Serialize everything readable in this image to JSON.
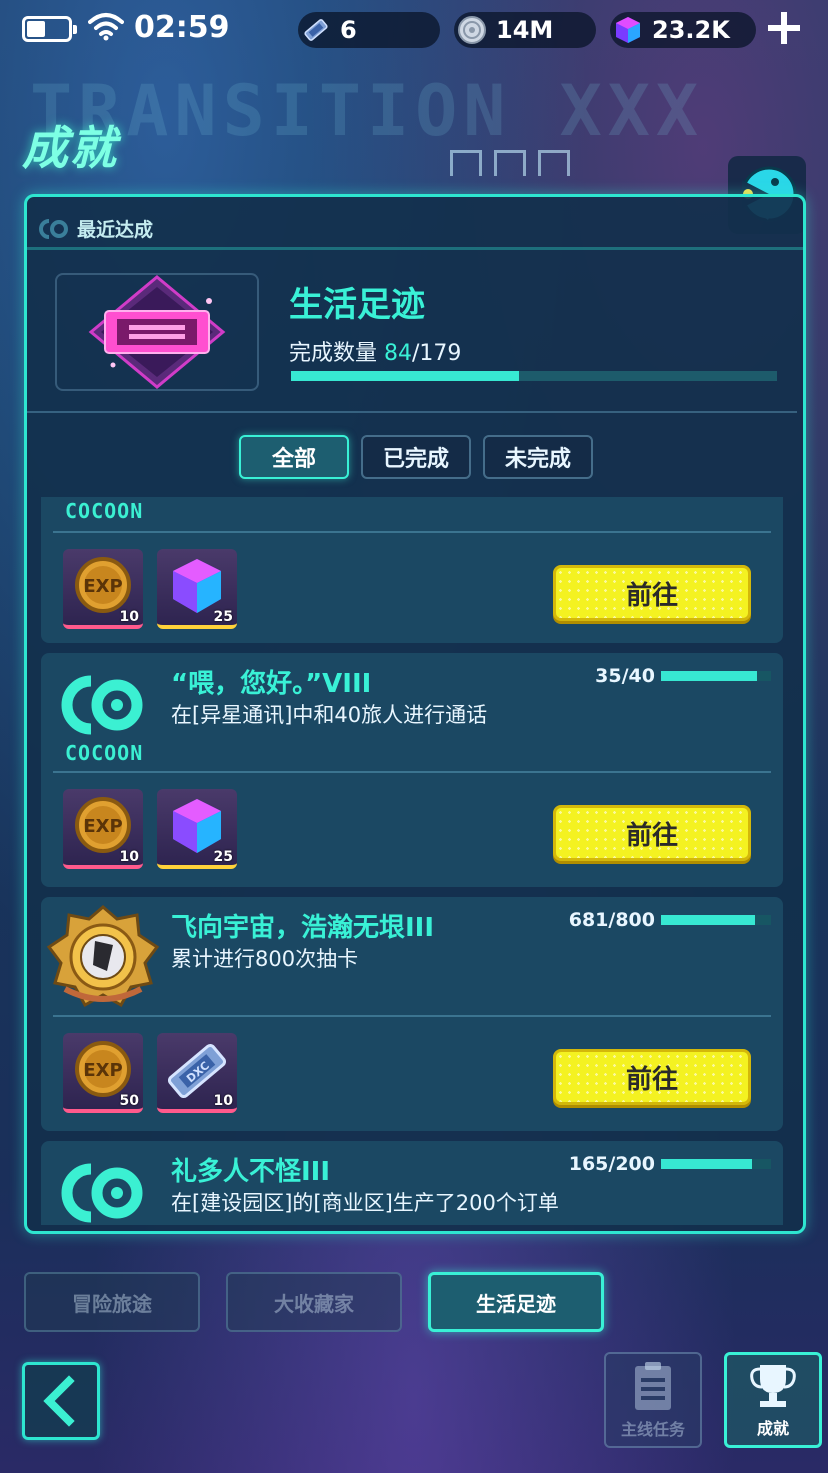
{
  "status_bar": {
    "time": "02:59",
    "resources": [
      {
        "icon": "ticket-icon",
        "value": "6"
      },
      {
        "icon": "coin-disc-icon",
        "value": "14M"
      },
      {
        "icon": "gem-cube-icon",
        "value": "23.2K"
      }
    ]
  },
  "page": {
    "title": "成就",
    "background_text": "TRANSITION XXX"
  },
  "recent": {
    "header": "最近达成",
    "category_title": "生活足迹",
    "count_label": "完成数量",
    "count_current": "84",
    "count_total": "/179",
    "progress": 0.47
  },
  "filters": [
    {
      "label": "全部",
      "active": true
    },
    {
      "label": "已完成",
      "active": false
    },
    {
      "label": "未完成",
      "active": false
    }
  ],
  "achievements": [
    {
      "partial": true,
      "brand": "COCOON",
      "rewards": [
        {
          "icon": "exp-coin-icon",
          "qty": "10"
        },
        {
          "icon": "gem-cube-icon",
          "qty": "25"
        }
      ],
      "button": "前往"
    },
    {
      "title": "“喂，您好。”VIII",
      "desc": "在[异星通讯]中和40旅人进行通话",
      "progress_text": "35/40",
      "progress": 0.875,
      "brand": "COCOON",
      "rewards": [
        {
          "icon": "exp-coin-icon",
          "qty": "10"
        },
        {
          "icon": "gem-cube-icon",
          "qty": "25"
        }
      ],
      "button": "前往"
    },
    {
      "title": "飞向宇宙，浩瀚无垠III",
      "desc": "累计进行800次抽卡",
      "progress_text": "681/800",
      "progress": 0.85,
      "rewards": [
        {
          "icon": "exp-coin-icon",
          "qty": "50"
        },
        {
          "icon": "ticket-icon",
          "qty": "10"
        }
      ],
      "button": "前往"
    },
    {
      "title": "礼多人不怪III",
      "desc": "在[建设园区]的[商业区]生产了200个订单",
      "progress_text": "165/200",
      "progress": 0.825
    }
  ],
  "category_tabs": [
    {
      "label": "冒险旅途",
      "active": false
    },
    {
      "label": "大收藏家",
      "active": false
    },
    {
      "label": "生活足迹",
      "active": true
    }
  ],
  "bottom_nav": [
    {
      "label": "主线任务",
      "icon": "clipboard-icon",
      "active": false
    },
    {
      "label": "成就",
      "icon": "trophy-icon",
      "active": true
    }
  ],
  "colors": {
    "accent": "#39f1d6",
    "button_yellow": "#f4f221",
    "panel": "#12304c"
  }
}
